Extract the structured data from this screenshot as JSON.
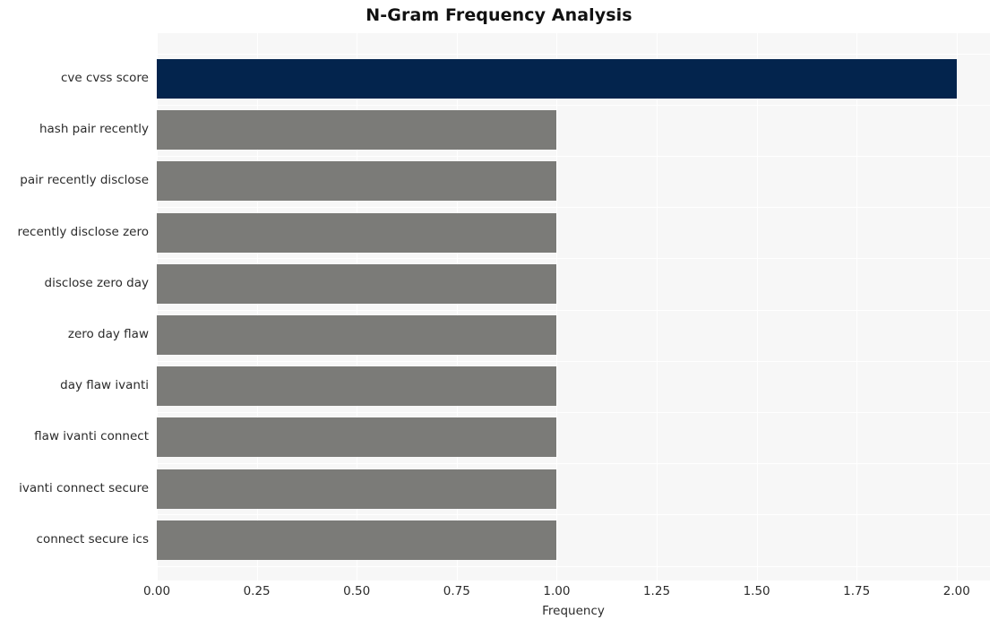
{
  "chart_data": {
    "type": "bar",
    "orientation": "horizontal",
    "title": "N-Gram Frequency Analysis",
    "xlabel": "Frequency",
    "ylabel": "",
    "categories": [
      "cve cvss score",
      "hash pair recently",
      "pair recently disclose",
      "recently disclose zero",
      "disclose zero day",
      "zero day flaw",
      "day flaw ivanti",
      "flaw ivanti connect",
      "ivanti connect secure",
      "connect secure ics"
    ],
    "values": [
      2,
      1,
      1,
      1,
      1,
      1,
      1,
      1,
      1,
      1
    ],
    "bar_colors": [
      "#03244d",
      "#7b7b78",
      "#7b7b78",
      "#7b7b78",
      "#7b7b78",
      "#7b7b78",
      "#7b7b78",
      "#7b7b78",
      "#7b7b78",
      "#7b7b78"
    ],
    "xlim": [
      0,
      2.0833
    ],
    "xticks": [
      0,
      0.25,
      0.5,
      0.75,
      1.0,
      1.25,
      1.5,
      1.75,
      2.0
    ],
    "xticklabels": [
      "0.00",
      "0.25",
      "0.50",
      "0.75",
      "1.00",
      "1.25",
      "1.50",
      "1.75",
      "2.00"
    ],
    "grid": true,
    "grid_color": "#ffffff",
    "legend": null,
    "plot_background": "#f7f7f7",
    "figure_background": "#ffffff",
    "highlight_color": "#03244d",
    "default_bar_color": "#7b7b78"
  }
}
